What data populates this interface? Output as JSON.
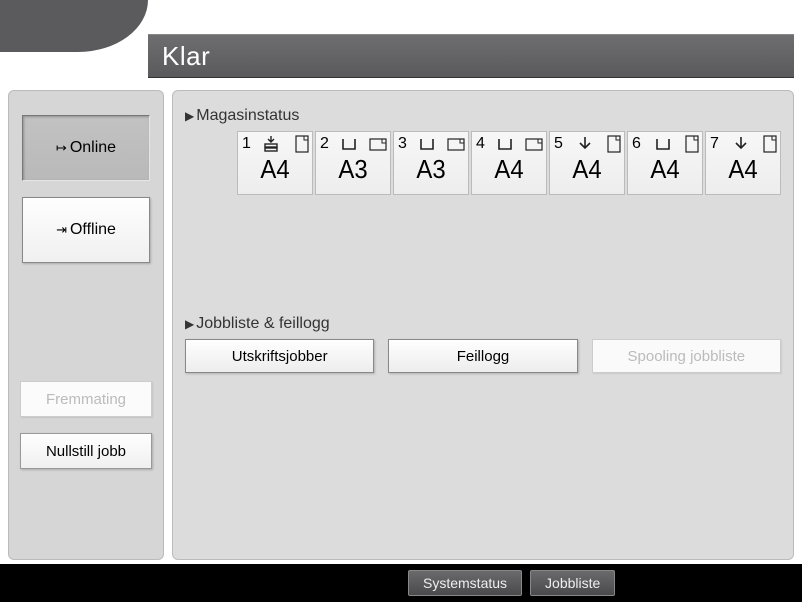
{
  "title": "Klar",
  "sidebar": {
    "online_label": "Online",
    "offline_label": "Offline",
    "feed_label": "Fremmating",
    "reset_label": "Nullstill jobb"
  },
  "main": {
    "tray_section_label": "Magasinstatus",
    "jobs_section_label": "Jobbliste & feillogg",
    "trays": [
      {
        "num": "1",
        "size": "A4",
        "level": "full",
        "orient": "portrait"
      },
      {
        "num": "2",
        "size": "A3",
        "level": "low",
        "orient": "landscape"
      },
      {
        "num": "3",
        "size": "A3",
        "level": "low",
        "orient": "landscape"
      },
      {
        "num": "4",
        "size": "A4",
        "level": "low",
        "orient": "landscape"
      },
      {
        "num": "5",
        "size": "A4",
        "level": "loading",
        "orient": "portrait"
      },
      {
        "num": "6",
        "size": "A4",
        "level": "low",
        "orient": "portrait"
      },
      {
        "num": "7",
        "size": "A4",
        "level": "loading",
        "orient": "portrait"
      }
    ],
    "job_buttons": {
      "print_jobs": "Utskriftsjobber",
      "error_log": "Feillogg",
      "spooling": "Spooling jobbliste"
    }
  },
  "bottombar": {
    "system_status": "Systemstatus",
    "job_list": "Jobbliste"
  }
}
